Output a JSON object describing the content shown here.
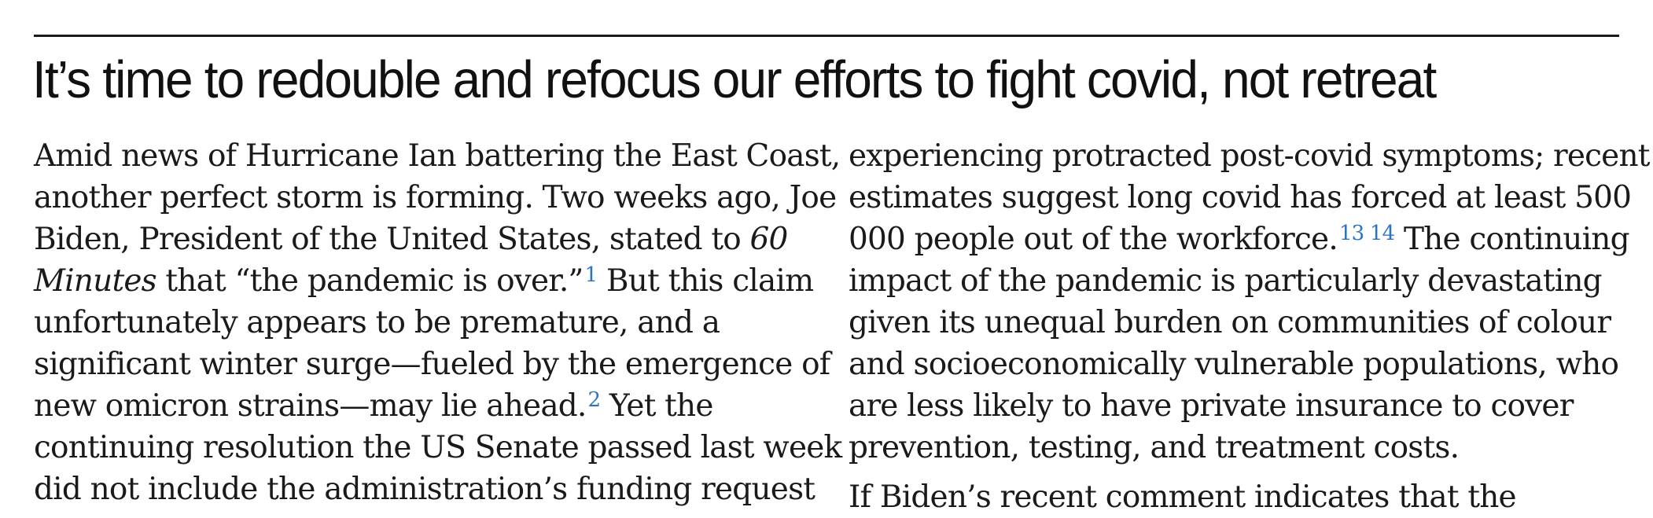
{
  "article": {
    "headline": "It’s time to redouble and refocus our efforts to fight covid, not retreat",
    "left_column": {
      "l1": "Amid news of Hurricane Ian battering the East Coast,",
      "l2": "another perfect storm is forming. Two weeks ago, Joe",
      "l3a": "Biden, President of the United States, stated to ",
      "l3b": "60",
      "l4a": "Minutes",
      "l4b": " that “the pandemic is over.”",
      "l4ref": "1",
      "l4c": " But this claim",
      "l5": "unfortunately appears to be premature, and a",
      "l6": "significant winter surge—fueled by the emergence of",
      "l7a": "new omicron strains—may lie ahead.",
      "l7ref": "2",
      "l7b": " Yet the",
      "l8": "continuing resolution the US Senate passed last week",
      "l9": "did not include the administration’s funding request"
    },
    "right_column": {
      "r1": "experiencing protracted post-covid symptoms; recent",
      "r2": "estimates suggest long covid has forced at least 500",
      "r3a": "000 people out of the workforce.",
      "r3ref": "13 14",
      "r3b": " The continuing",
      "r4": "impact of the pandemic is particularly devastating",
      "r5": "given its unequal burden on communities of colour",
      "r6": "and socioeconomically vulnerable populations, who",
      "r7": "are less likely to have private insurance to cover",
      "r8": "prevention, testing, and treatment costs.",
      "r9": "If Biden’s recent comment indicates that the"
    },
    "colors": {
      "text": "#1a1a1a",
      "reference_link": "#2b74c4",
      "rule": "#1a1a1a"
    }
  }
}
